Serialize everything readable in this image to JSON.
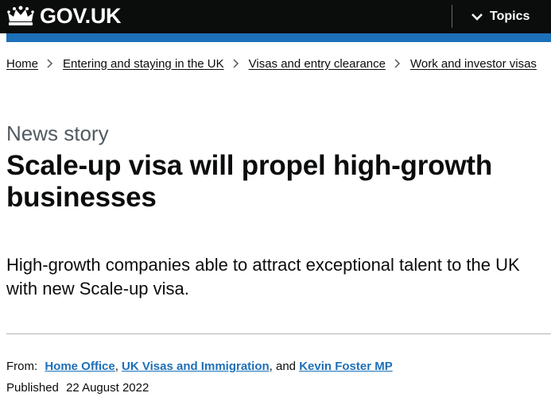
{
  "header": {
    "logo_text": "GOV.UK",
    "topics_label": "Topics",
    "icons": [
      "crown-icon",
      "chevron-down-icon"
    ]
  },
  "breadcrumbs": [
    {
      "label": "Home"
    },
    {
      "label": "Entering and staying in the UK"
    },
    {
      "label": "Visas and entry clearance"
    },
    {
      "label": "Work and investor visas"
    }
  ],
  "article": {
    "caption": "News story",
    "title": "Scale-up visa will propel high-growth businesses",
    "lede": "High-growth companies able to attract exceptional talent to the UK with new Scale-up visa."
  },
  "metadata": {
    "from_label": "From:",
    "organisations": [
      "Home Office",
      "UK Visas and Immigration",
      "Kevin Foster MP"
    ],
    "separator": ",",
    "and_text": ", and",
    "published_label": "Published",
    "published_date": "22 August 2022"
  },
  "colors": {
    "header_bg": "#0b0c0c",
    "accent_blue": "#1d70b8",
    "text": "#0b0c0c",
    "secondary_text": "#505a5f"
  }
}
